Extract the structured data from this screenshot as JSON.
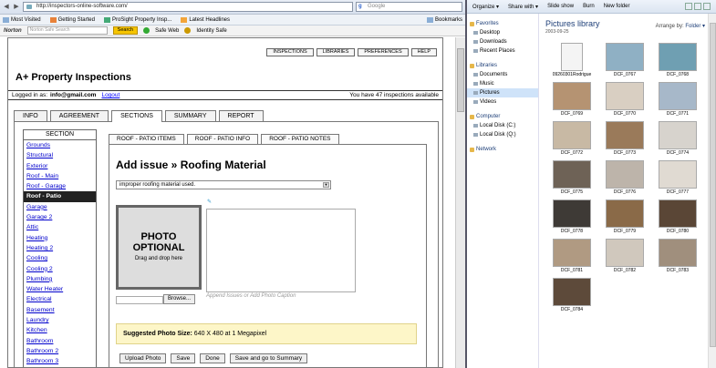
{
  "browser": {
    "url": "http://inspectors-online-software.com/",
    "search_placeholder": "Google",
    "bookmarks": [
      "Most Visited",
      "Getting Started",
      "ProSight Property Insp...",
      "Latest Headlines"
    ],
    "bookmarks_right": "Bookmarks",
    "norton": {
      "logo": "Norton",
      "search_placeholder": "Norton Safe Search",
      "search_button": "Search",
      "safe_web": "Safe Web",
      "identity_safe": "Identity Safe"
    }
  },
  "site": {
    "top_buttons": [
      "INSPECTIONS",
      "LIBRARIES",
      "PREFERENCES",
      "HELP"
    ],
    "brand": "A+ Property Inspections",
    "logged_in_label": "Logged in as:",
    "logged_in_email": "info@gmail.com",
    "logout": "Logout",
    "inspections_available": "You have 47 inspections available",
    "tabs": [
      "INFO",
      "AGREEMENT",
      "SECTIONS",
      "SUMMARY",
      "REPORT"
    ],
    "active_tab": "SECTIONS",
    "section_header": "SECTION",
    "sections": [
      "Grounds",
      "Structural",
      "Exterior",
      "Roof - Main",
      "Roof - Garage",
      "Roof - Patio",
      "Garage",
      "Garage 2",
      "Attic",
      "Heating",
      "Heating 2",
      "Cooling",
      "Cooling 2",
      "Plumbing",
      "Water Heater",
      "Electrical",
      "Basement",
      "Laundry",
      "Kitchen",
      "Bathroom",
      "Bathroom 2",
      "Bathroom 3"
    ],
    "active_section": "Roof - Patio",
    "sub_tabs": [
      "ROOF - PATIO ITEMS",
      "ROOF - PATIO INFO",
      "ROOF - PATIO NOTES"
    ],
    "issue_title": "Add issue » Roofing Material",
    "issue_select": "improper roofing material used.",
    "photo_title": "PHOTO OPTIONAL",
    "photo_sub": "Drag and drop here",
    "browse": "Browse...",
    "caption_placeholder": "Append Issues or Add Photo Caption",
    "suggest_label": "Suggested Photo Size:",
    "suggest_value": "640 X 480 at 1 Megapixel",
    "buttons": [
      "Upload Photo",
      "Save",
      "Done",
      "Save and go to Summary"
    ]
  },
  "explorer": {
    "toolbar": [
      "Organize ▾",
      "Share with ▾",
      "Slide show",
      "Burn",
      "New folder"
    ],
    "favorites_header": "Favorites",
    "favorites": [
      "Desktop",
      "Downloads",
      "Recent Places"
    ],
    "libraries_header": "Libraries",
    "libraries": [
      "Documents",
      "Music",
      "Pictures",
      "Videos"
    ],
    "selected_library": "Pictures",
    "computer_header": "Computer",
    "computer": [
      "Local Disk (C:)",
      "Local Disk (Q:)"
    ],
    "network": "Network",
    "title": "Pictures library",
    "date": "2003-09-25",
    "arrange_label": "Arrange by:",
    "arrange_value": "Folder ▾",
    "files": [
      {
        "name": "09260301Rodrigue",
        "color": "#f4f4f4"
      },
      {
        "name": "DCF_0767",
        "color": "#8fb0c4"
      },
      {
        "name": "DCF_0768",
        "color": "#6f9fb2"
      },
      {
        "name": "DCF_0769",
        "color": "#b59372"
      },
      {
        "name": "DCF_0770",
        "color": "#d9cfc2"
      },
      {
        "name": "DCF_0771",
        "color": "#a7b8c9"
      },
      {
        "name": "DCF_0772",
        "color": "#c8b9a4"
      },
      {
        "name": "DCF_0773",
        "color": "#9a7a5a"
      },
      {
        "name": "DCF_0774",
        "color": "#d7d3cd"
      },
      {
        "name": "DCF_0775",
        "color": "#6e6256"
      },
      {
        "name": "DCF_0776",
        "color": "#bdb4aa"
      },
      {
        "name": "DCF_0777",
        "color": "#e0dad2"
      },
      {
        "name": "DCF_0778",
        "color": "#3e3a36"
      },
      {
        "name": "DCF_0779",
        "color": "#8a6a48"
      },
      {
        "name": "DCF_0780",
        "color": "#5a4636"
      },
      {
        "name": "DCF_0781",
        "color": "#b09a82"
      },
      {
        "name": "DCF_0782",
        "color": "#d0c8bd"
      },
      {
        "name": "DCF_0783",
        "color": "#a08f7d"
      },
      {
        "name": "DCF_0784",
        "color": "#5d4a3a"
      }
    ]
  }
}
